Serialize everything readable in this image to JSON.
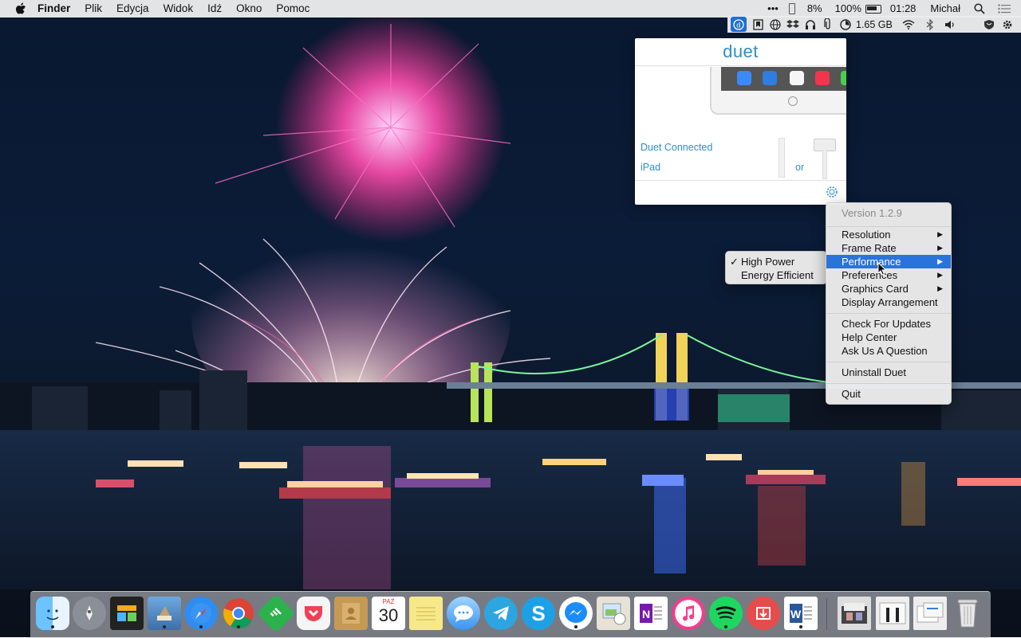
{
  "menubar": {
    "app_name": "Finder",
    "menus": [
      "Plik",
      "Edycja",
      "Widok",
      "Idź",
      "Okno",
      "Pomoc"
    ],
    "status": {
      "overflow": "•••",
      "battery_small": "8%",
      "battery": "100%",
      "time": "01:28",
      "user": "Michał"
    }
  },
  "tray": {
    "ram": "1.65 GB",
    "icons": [
      "duet-icon",
      "bookmark-icon",
      "globe-icon",
      "dropbox-icon",
      "headphones-icon",
      "paperclip-icon",
      "ram-icon",
      "wifi-icon",
      "bluetooth-icon",
      "volume-icon",
      "shield-icon",
      "gear-icon"
    ]
  },
  "duet": {
    "logo": "duet",
    "status": "Duet Connected",
    "device": "iPad",
    "or": "or"
  },
  "menu": {
    "version": "Version 1.2.9",
    "items": [
      "Resolution",
      "Frame Rate",
      "Performance",
      "Preferences",
      "Graphics Card",
      "Display Arrangement"
    ],
    "items2": [
      "Check For Updates",
      "Help Center",
      "Ask Us A Question"
    ],
    "uninstall": "Uninstall Duet",
    "quit": "Quit"
  },
  "submenu": {
    "check": "✓",
    "items": [
      "High Power",
      "Energy Efficient"
    ]
  },
  "dock": {
    "calendar_day": "30",
    "calendar_month": "PAŹ",
    "apps": [
      "finder-icon",
      "launchpad-icon",
      "activity-icon",
      "mail-icon",
      "safari-icon",
      "chrome-icon",
      "feedly-icon",
      "pocket-icon",
      "contacts-icon",
      "calendar-icon",
      "notes-icon",
      "messages-icon",
      "telegram-icon",
      "skype-icon",
      "messenger-icon",
      "preview-icon",
      "onenote-icon",
      "itunes-icon",
      "spotify-icon",
      "downloader-icon",
      "word-icon",
      "folder-icon",
      "documents-icon",
      "files-icon",
      "trash-icon"
    ]
  },
  "colors": {
    "accent": "#2a73db",
    "duet_blue": "#2d8ec9"
  }
}
